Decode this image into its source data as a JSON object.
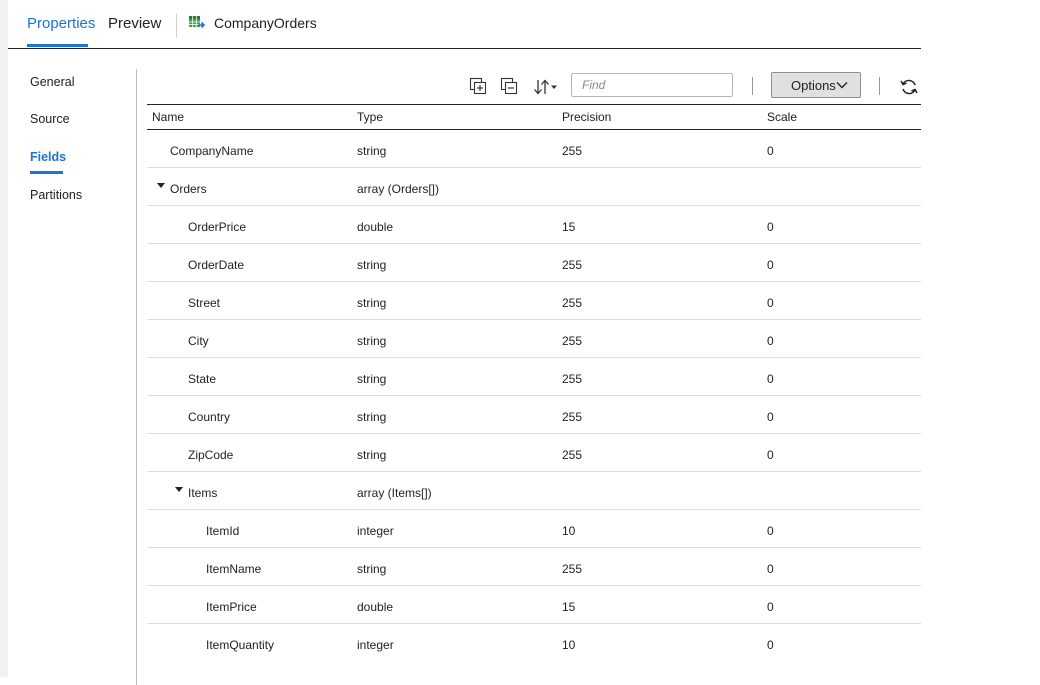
{
  "tabs": [
    {
      "label": "Properties",
      "active": true
    },
    {
      "label": "Preview",
      "active": false
    }
  ],
  "object": {
    "name": "CompanyOrders",
    "icon": "table-icon"
  },
  "nav": [
    {
      "label": "General",
      "active": false
    },
    {
      "label": "Source",
      "active": false
    },
    {
      "label": "Fields",
      "active": true
    },
    {
      "label": "Partitions",
      "active": false
    }
  ],
  "toolbar": {
    "expand_icon": "expand-all-icon",
    "collapse_icon": "collapse-all-icon",
    "sort_icon": "sort-icon",
    "find_placeholder": "Find",
    "options_label": "Options",
    "refresh_icon": "refresh-icon"
  },
  "table": {
    "headers": [
      "Name",
      "Type",
      "Precision",
      "Scale"
    ],
    "rows": [
      {
        "name": "CompanyName",
        "type": "string",
        "precision": "255",
        "scale": "0",
        "level": 0,
        "expandable": false
      },
      {
        "name": "Orders",
        "type": "array (Orders[])",
        "precision": "",
        "scale": "",
        "level": 0,
        "expandable": true
      },
      {
        "name": "OrderPrice",
        "type": "double",
        "precision": "15",
        "scale": "0",
        "level": 1,
        "expandable": false
      },
      {
        "name": "OrderDate",
        "type": "string",
        "precision": "255",
        "scale": "0",
        "level": 1,
        "expandable": false
      },
      {
        "name": "Street",
        "type": "string",
        "precision": "255",
        "scale": "0",
        "level": 1,
        "expandable": false
      },
      {
        "name": "City",
        "type": "string",
        "precision": "255",
        "scale": "0",
        "level": 1,
        "expandable": false
      },
      {
        "name": "State",
        "type": "string",
        "precision": "255",
        "scale": "0",
        "level": 1,
        "expandable": false
      },
      {
        "name": "Country",
        "type": "string",
        "precision": "255",
        "scale": "0",
        "level": 1,
        "expandable": false
      },
      {
        "name": "ZipCode",
        "type": "string",
        "precision": "255",
        "scale": "0",
        "level": 1,
        "expandable": false
      },
      {
        "name": "Items",
        "type": "array (Items[])",
        "precision": "",
        "scale": "",
        "level": 1,
        "expandable": true
      },
      {
        "name": "ItemId",
        "type": "integer",
        "precision": "10",
        "scale": "0",
        "level": 2,
        "expandable": false
      },
      {
        "name": "ItemName",
        "type": "string",
        "precision": "255",
        "scale": "0",
        "level": 2,
        "expandable": false
      },
      {
        "name": "ItemPrice",
        "type": "double",
        "precision": "15",
        "scale": "0",
        "level": 2,
        "expandable": false
      },
      {
        "name": "ItemQuantity",
        "type": "integer",
        "precision": "10",
        "scale": "0",
        "level": 2,
        "expandable": false
      }
    ]
  },
  "colors": {
    "accent": "#1a73d6",
    "text": "#222222",
    "grid": "#dedede",
    "options_bg": "#e0e0e0"
  }
}
